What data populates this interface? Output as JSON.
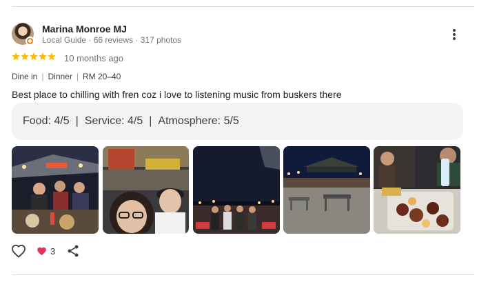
{
  "reviewer": {
    "name": "Marina Monroe MJ",
    "meta": "Local Guide · 66 reviews · 317 photos"
  },
  "review": {
    "rating": 5,
    "date": "10 months ago",
    "tags": [
      "Dine in",
      "Dinner",
      "RM 20–40"
    ],
    "text": "Best place to chilling with fren coz i love to listening music from buskers there",
    "sub_ratings": {
      "food": "Food: 4/5",
      "service": "Service: 4/5",
      "atmosphere": "Atmosphere: 5/5"
    }
  },
  "photos": [
    {
      "subject": "group-selfie-at-dinner-table"
    },
    {
      "subject": "two-women-selfie-at-night-market"
    },
    {
      "subject": "group-photo-under-night-sky"
    },
    {
      "subject": "open-air-seating-with-canopy"
    },
    {
      "subject": "grilled-food-platter-on-table"
    }
  ],
  "actions": {
    "reaction_count": "3"
  },
  "colors": {
    "star": "#fbbc04",
    "heart": "#e8315a",
    "ratings_bg": "#f1f3f4",
    "badge": "#e8710a"
  },
  "icons": [
    "more-vert-icon",
    "star-icon",
    "heart-outline-icon",
    "heart-filled-icon",
    "share-icon"
  ]
}
